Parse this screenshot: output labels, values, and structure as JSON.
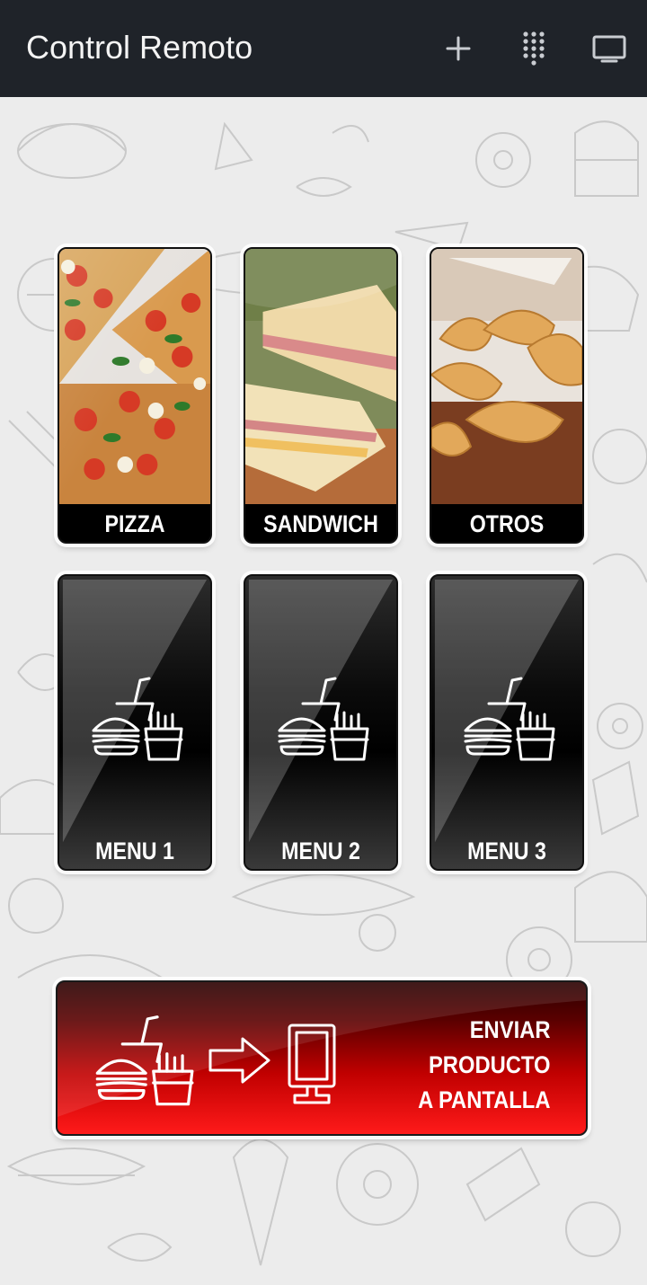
{
  "appbar": {
    "title": "Control Remoto",
    "actions": [
      {
        "icon": "plus-icon"
      },
      {
        "icon": "dialpad-icon"
      },
      {
        "icon": "cast-screen-icon"
      }
    ]
  },
  "categories": [
    {
      "label": "PIZZA",
      "image": "pizza-photo"
    },
    {
      "label": "SANDWICH",
      "image": "sandwich-photo"
    },
    {
      "label": "OTROS",
      "image": "empanadas-photo"
    }
  ],
  "menus": [
    {
      "label": "MENU 1",
      "icon": "combo-meal-icon"
    },
    {
      "label": "MENU 2",
      "icon": "combo-meal-icon"
    },
    {
      "label": "MENU 3",
      "icon": "combo-meal-icon"
    }
  ],
  "send_button": {
    "lines": [
      "ENVIAR",
      "PRODUCTO",
      "A PANTALLA"
    ],
    "icons": [
      "combo-meal-icon",
      "arrow-right-icon",
      "display-stand-icon"
    ]
  },
  "colors": {
    "appbar": "#1f2329",
    "send_red": "#e00000"
  }
}
